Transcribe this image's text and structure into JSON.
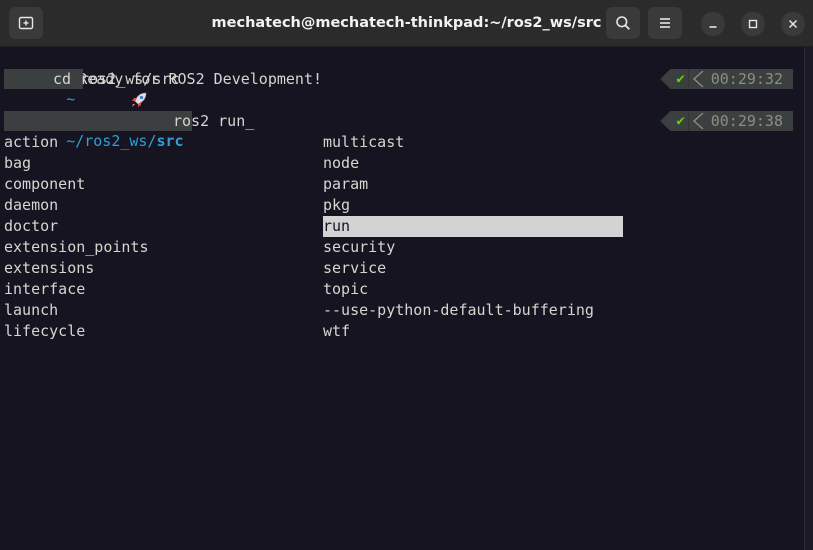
{
  "window": {
    "title": "mechatech@mechatech-thinkpad:~/ros2_ws/src"
  },
  "terminal": {
    "banner_icon": "rocket-icon",
    "banner_text": "Ready for ROS2 Development!",
    "prompt1": {
      "dir": "~",
      "command": "cd ros2_ws/src",
      "status": "✔",
      "time": "00:29:32"
    },
    "prompt2": {
      "dir_prefix": "~/ros2_ws/",
      "dir_current": "src",
      "command": "ros2 run_",
      "status": "✔",
      "time": "00:29:38"
    },
    "completions_left": [
      "action",
      "bag",
      "component",
      "daemon",
      "doctor",
      "extension_points",
      "extensions",
      "interface",
      "launch",
      "lifecycle"
    ],
    "completions_right": [
      "multicast",
      "node",
      "param",
      "pkg",
      "run",
      "security",
      "service",
      "topic",
      "--use-python-default-buffering",
      "wtf"
    ],
    "selected_completion": "run"
  },
  "colors": {
    "background": "#171421",
    "titlebar": "#2b2b2b",
    "prompt_segment": "#3b3f40",
    "accent_cyan": "#2aa1d8",
    "check_green": "#5fd700",
    "text": "#d3d7cf"
  }
}
